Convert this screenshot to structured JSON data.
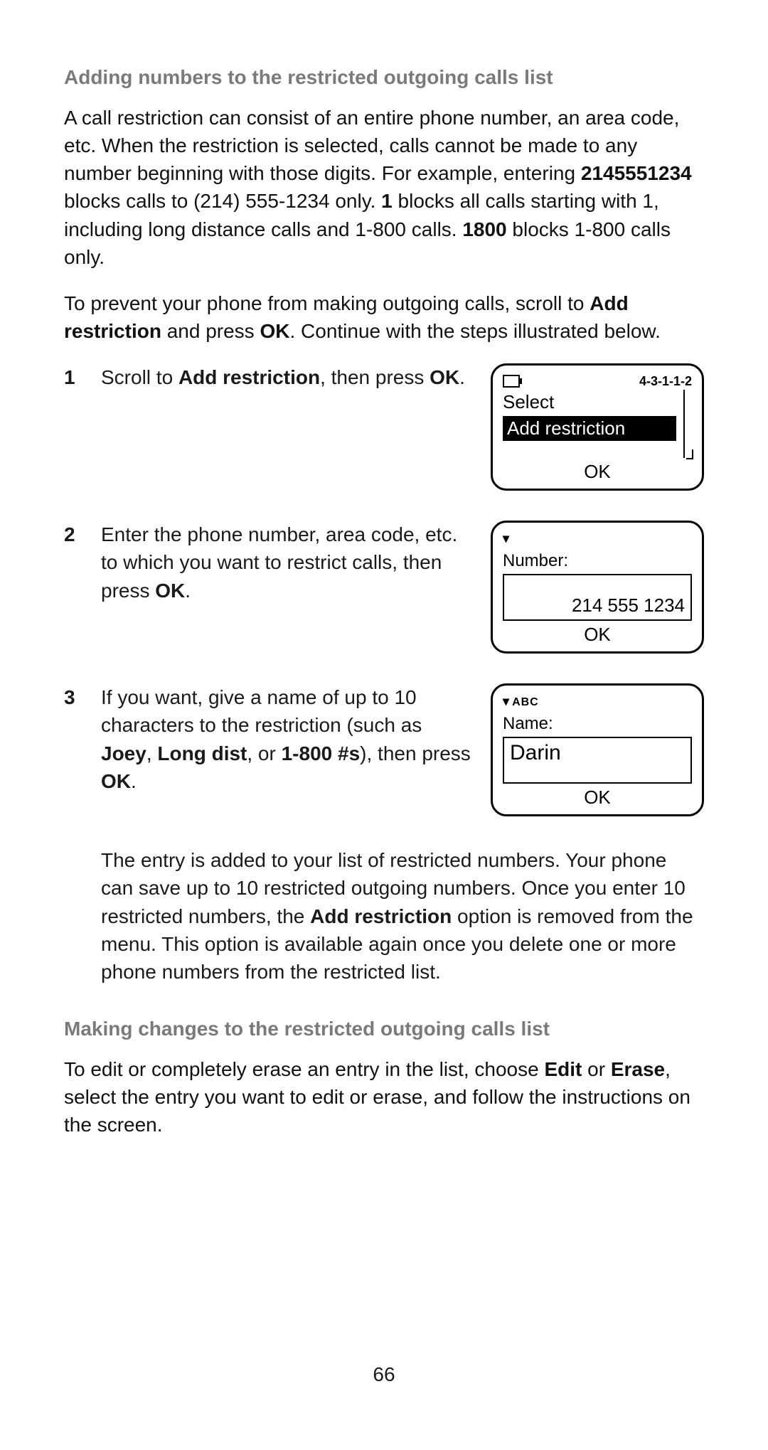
{
  "heading1": "Adding numbers to the restricted outgoing calls list",
  "intro1a": "A call restriction can consist of an entire phone number, an area code, etc. When the restriction is selected, calls cannot be made to any number beginning with those digits. For example, entering ",
  "intro1_bold1": "2145551234",
  "intro1b": " blocks calls to (214) 555-1234 only. ",
  "intro1_bold2": "1",
  "intro1c": " blocks all calls starting with 1, including long distance calls and 1-800 calls. ",
  "intro1_bold3": "1800",
  "intro1d": " blocks 1-800 calls only.",
  "intro2a": "To prevent your phone from making outgoing calls, scroll to ",
  "intro2_bold1": "Add restriction",
  "intro2b": " and press ",
  "intro2_bold2": "OK",
  "intro2c": ". Continue with the steps illustrated below.",
  "steps": {
    "1": {
      "index": "1",
      "a": "Scroll to ",
      "b1": "Add restriction",
      "b": ", then press ",
      "b2": "OK",
      "c": "."
    },
    "2": {
      "index": "2",
      "a": "Enter the phone number, area code, etc. to which you want to restrict calls, then press ",
      "b1": "OK",
      "b": "."
    },
    "3": {
      "index": "3",
      "a": "If you want, give a name of up to 10 characters to the restriction (such as ",
      "b1": "Joey",
      "b": ", ",
      "b2": "Long dist",
      "c": ", or ",
      "b3": "1-800 #s",
      "d": "), then press ",
      "b4": "OK",
      "e": "."
    },
    "extra_a": "The entry is added to your list of restricted numbers. Your phone can save up to 10 restricted outgoing numbers. Once you enter 10 restricted numbers, the ",
    "extra_bold": "Add restriction",
    "extra_b": " option is removed from the menu. This option is available again once you delete one or more phone numbers from the restricted list."
  },
  "screens": {
    "s1": {
      "menu_path": "4-3-1-1-2",
      "title": "Select",
      "highlight": "Add restriction",
      "ok": "OK"
    },
    "s2": {
      "label": "Number:",
      "value": "214 555 1234",
      "ok": "OK",
      "signal": "▾"
    },
    "s3": {
      "mode": "ABC",
      "label": "Name:",
      "value": "Darin",
      "ok": "OK",
      "signal": "▾"
    }
  },
  "heading2": "Making changes to the restricted outgoing calls list",
  "edit_a": "To edit or completely erase an entry in the list, choose ",
  "edit_b1": "Edit",
  "edit_b": " or ",
  "edit_b2": "Erase",
  "edit_c": ", select the entry you want to edit or erase, and follow the instructions on the screen.",
  "page_number": "66"
}
